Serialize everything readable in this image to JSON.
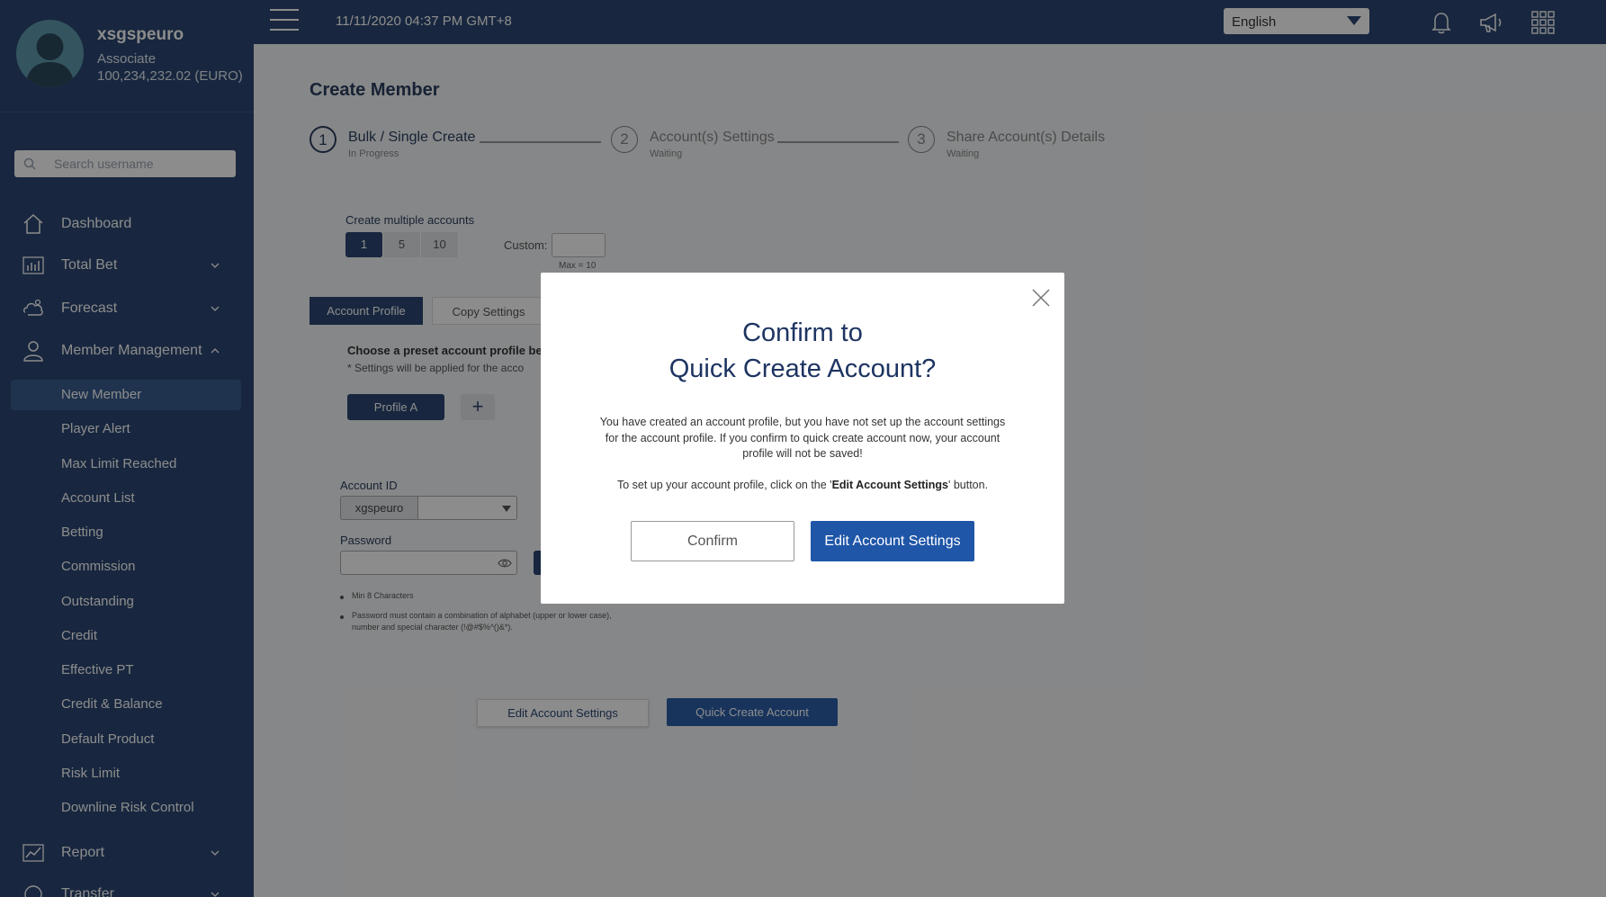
{
  "user": {
    "username": "xsgspeuro",
    "role": "Associate",
    "balance": "100,234,232.02 (EURO)"
  },
  "search": {
    "placeholder": "Search username"
  },
  "nav": {
    "dashboard": "Dashboard",
    "total_bet": "Total Bet",
    "forecast": "Forecast",
    "member_management": "Member Management",
    "report": "Report",
    "transfer": "Transfer"
  },
  "submenu": [
    "New Member",
    "Player Alert",
    "Max Limit Reached",
    "Account List",
    "Betting",
    "Commission",
    "Outstanding",
    "Credit",
    "Effective PT",
    "Credit & Balance",
    "Default Product",
    "Risk Limit",
    "Downline Risk Control"
  ],
  "topbar": {
    "datetime": "11/11/2020 04:37 PM GMT+8",
    "language": "English"
  },
  "page": {
    "title": "Create Member",
    "steps": [
      {
        "num": "1",
        "title": "Bulk / Single Create",
        "status": "In Progress"
      },
      {
        "num": "2",
        "title": "Account(s) Settings",
        "status": "Waiting"
      },
      {
        "num": "3",
        "title": "Share Account(s) Details",
        "status": "Waiting"
      }
    ],
    "create_multiple_label": "Create multiple accounts",
    "counts": [
      "1",
      "5",
      "10"
    ],
    "custom_label": "Custom:",
    "custom_max": "Max = 10",
    "tabs": [
      "Account Profile",
      "Copy Settings"
    ],
    "preset_text": "Choose a preset account profile belo",
    "preset_note": "* Settings will be applied for the acco",
    "profile_a": "Profile A",
    "plus": "+",
    "account_id_label": "Account ID",
    "account_id_prefix": "xgspeuro",
    "password_label": "Password",
    "rule1": "Min 8 Characters",
    "rule2a": "Password must contain a combination of alphabet (upper or lower case),",
    "rule2b": "number and special character (!@#$%^()&*).",
    "edit_settings_btn": "Edit Account Settings",
    "quick_create_btn": "Quick Create Account"
  },
  "modal": {
    "title_line1": "Confirm to",
    "title_line2": "Quick Create Account?",
    "body1": "You have created an account profile, but you have not set up  the account settings for the account profile. If you confirm to quick create account now, your account profile will not be saved!",
    "body2_pre": "To set up your account profile, click on the '",
    "body2_bold": "Edit Account Settings",
    "body2_post": "' button.",
    "confirm": "Confirm",
    "edit": "Edit Account Settings"
  },
  "colors": {
    "sidebar": "#2c4873",
    "primary_button": "#1f56a8",
    "title": "#1d3461"
  }
}
